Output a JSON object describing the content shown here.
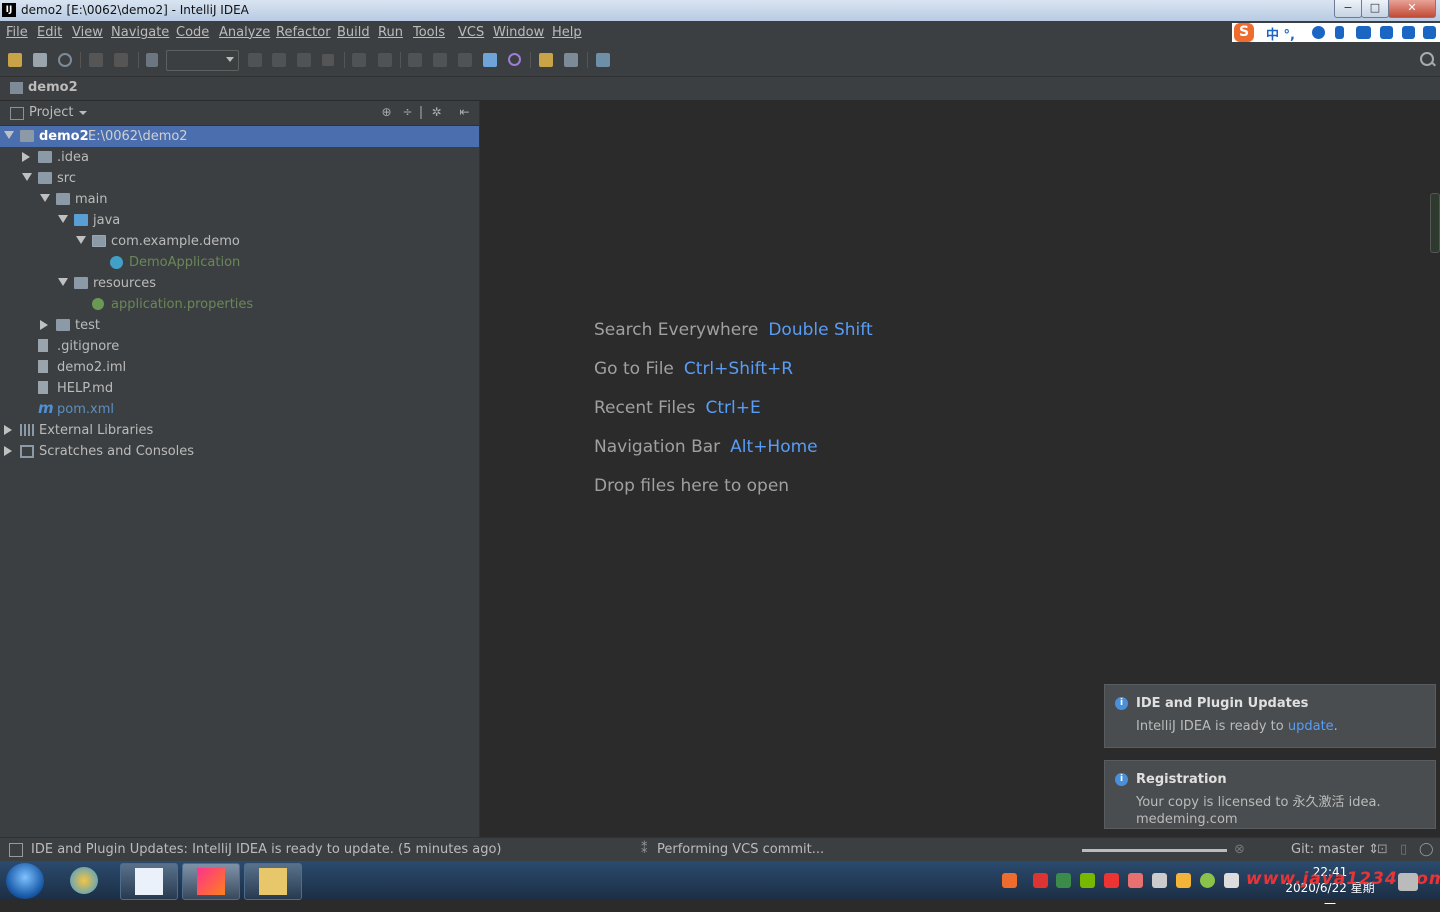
{
  "window": {
    "title": "demo2 [E:\\0062\\demo2] - IntelliJ IDEA",
    "logo": "IJ"
  },
  "window_buttons": {
    "minimize": "−",
    "maximize": "□",
    "close": "✕"
  },
  "menu": [
    "File",
    "Edit",
    "View",
    "Navigate",
    "Code",
    "Analyze",
    "Refactor",
    "Build",
    "Run",
    "Tools",
    "VCS",
    "Window",
    "Help"
  ],
  "ime": {
    "logo": "S",
    "text": "中 °,"
  },
  "navbar": {
    "crumb": "demo2"
  },
  "project": {
    "header": "Project",
    "tree": [
      {
        "label": "demo2",
        "path": "E:\\0062\\demo2",
        "depth": 0,
        "arrow": "open",
        "icon": "module-folder",
        "style": "bold",
        "selected": true
      },
      {
        "label": ".idea",
        "depth": 1,
        "arrow": "closed",
        "icon": "folder"
      },
      {
        "label": "src",
        "depth": 1,
        "arrow": "open",
        "icon": "folder"
      },
      {
        "label": "main",
        "depth": 2,
        "arrow": "open",
        "icon": "folder"
      },
      {
        "label": "java",
        "depth": 3,
        "arrow": "open",
        "icon": "folder-blue"
      },
      {
        "label": "com.example.demo",
        "depth": 4,
        "arrow": "open",
        "icon": "package"
      },
      {
        "label": "DemoApplication",
        "depth": 5,
        "arrow": "none",
        "icon": "spring-class",
        "style": "green"
      },
      {
        "label": "resources",
        "depth": 3,
        "arrow": "open",
        "icon": "folder-res"
      },
      {
        "label": "application.properties",
        "depth": 4,
        "arrow": "none",
        "icon": "spring-file",
        "style": "green"
      },
      {
        "label": "test",
        "depth": 2,
        "arrow": "closed",
        "icon": "folder"
      },
      {
        "label": ".gitignore",
        "depth": 1,
        "arrow": "none",
        "icon": "file"
      },
      {
        "label": "demo2.iml",
        "depth": 1,
        "arrow": "none",
        "icon": "file"
      },
      {
        "label": "HELP.md",
        "depth": 1,
        "arrow": "none",
        "icon": "file"
      },
      {
        "label": "pom.xml",
        "depth": 1,
        "arrow": "none",
        "icon": "maven",
        "style": "blue"
      },
      {
        "label": "External Libraries",
        "depth": 0,
        "arrow": "closed",
        "icon": "library"
      },
      {
        "label": "Scratches and Consoles",
        "depth": 0,
        "arrow": "closed",
        "icon": "scratch"
      }
    ]
  },
  "editor_hints": [
    {
      "text": "Search Everywhere",
      "key": "Double Shift"
    },
    {
      "text": "Go to File",
      "key": "Ctrl+Shift+R"
    },
    {
      "text": "Recent Files",
      "key": "Ctrl+E"
    },
    {
      "text": "Navigation Bar",
      "key": "Alt+Home"
    },
    {
      "text": "Drop files here to open",
      "key": ""
    }
  ],
  "notifications": {
    "updates": {
      "title": "IDE and Plugin Updates",
      "body": "IntelliJ IDEA is ready to ",
      "link": "update",
      "suffix": "."
    },
    "registration": {
      "title": "Registration",
      "line1": "Your copy is licensed to 永久激活 idea.",
      "line2": "medeming.com"
    }
  },
  "statusbar": {
    "message": "IDE and Plugin Updates: IntelliJ IDEA is ready to update. (5 minutes ago)",
    "task": "Performing VCS commit...",
    "git": "Git: master ⇕"
  },
  "taskbar": {
    "clock_time": "22:41",
    "clock_date": "2020/6/22 星期一",
    "watermark": "www.java1234.com"
  },
  "colors": {
    "selection": "#4b6eaf",
    "key_blue": "#589df6",
    "spring_green": "#6a8759",
    "editor_bg": "#2b2b2b",
    "panel_bg": "#3c3f41"
  }
}
